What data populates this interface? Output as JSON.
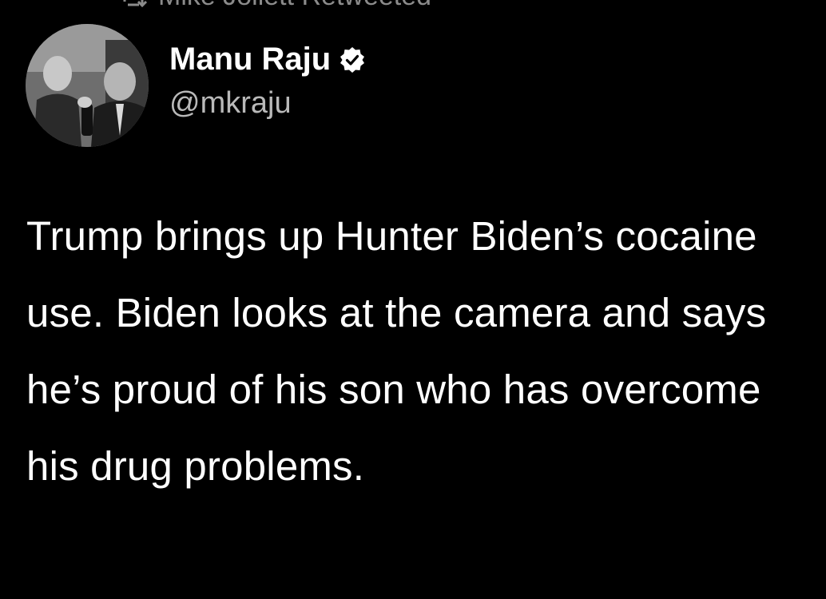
{
  "retweet": {
    "label": "Mike Jollett Retweeted",
    "icon": "retweet-icon"
  },
  "author": {
    "name": "Manu Raju",
    "handle": "@mkraju",
    "verified": true,
    "verified_icon": "verified-badge-icon",
    "avatar": "avatar-photo"
  },
  "tweet": {
    "text": "Trump brings up Hunter Biden’s cocaine use. Biden looks at the camera and says he’s proud of his son who has overcome his drug problems."
  },
  "colors": {
    "background": "#000000",
    "text": "#ffffff",
    "secondary": "#b9b9b9"
  }
}
